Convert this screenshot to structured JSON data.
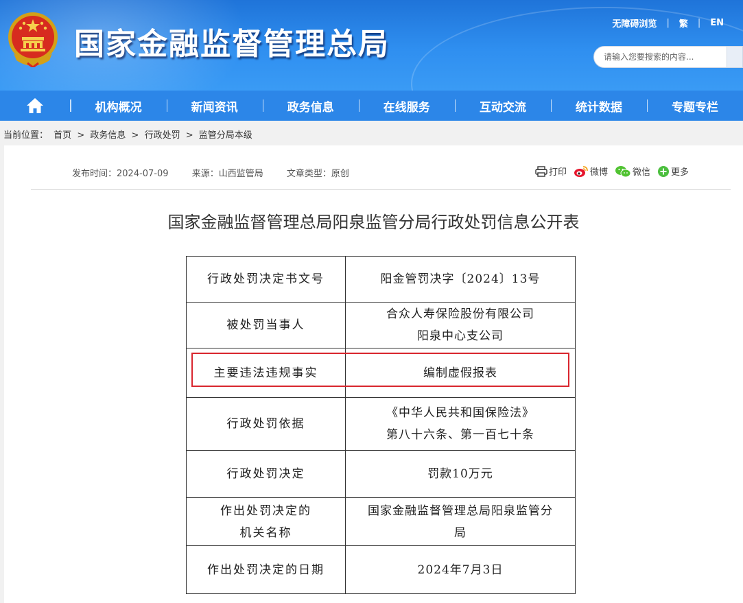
{
  "header": {
    "site_title": "国家金融监督管理总局",
    "links": [
      "无障碍浏览",
      "繁",
      "EN"
    ],
    "search_placeholder": "请输入您要搜索的内容..."
  },
  "nav": {
    "items": [
      "机构概况",
      "新闻资讯",
      "政务信息",
      "在线服务",
      "互动交流",
      "统计数据",
      "专题专栏"
    ]
  },
  "breadcrumb": {
    "label": "当前位置：",
    "items": [
      "首页",
      "政务信息",
      "行政处罚",
      "监管分局本级"
    ],
    "sep": ">"
  },
  "article": {
    "publish_time": "发布时间：2024-07-09",
    "source": "来源：山西监管局",
    "type": "文章类型：原创",
    "share": [
      "打印",
      "微博",
      "微信",
      "更多"
    ],
    "title": "国家金融监督管理总局阳泉监管分局行政处罚信息公开表"
  },
  "table": {
    "rows": [
      {
        "key": "行政处罚决定书文号",
        "value": [
          "阳金管罚决字〔2024〕13号"
        ]
      },
      {
        "key": "被处罚当事人",
        "value": [
          "合众人寿保险股份有限公司",
          "阳泉中心支公司"
        ]
      },
      {
        "key": "主要违法违规事实",
        "value": [
          "编制虚假报表"
        ]
      },
      {
        "key": "行政处罚依据",
        "value": [
          "《中华人民共和国保险法》",
          "第八十六条、第一百七十条"
        ]
      },
      {
        "key": "行政处罚决定",
        "value": [
          "罚款10万元"
        ]
      },
      {
        "key": "作出处罚决定的机关名称",
        "key_lines": [
          "作出处罚决定的",
          "机关名称"
        ],
        "value": [
          "国家金融监督管理总局阳泉监管分",
          "局"
        ]
      },
      {
        "key": "作出处罚决定的日期",
        "value": [
          "2024年7月3日"
        ]
      }
    ]
  },
  "colors": {
    "header_blue": "#2f8ff0",
    "nav_blue": "#2c86e8",
    "highlight_red": "#d9262e"
  }
}
